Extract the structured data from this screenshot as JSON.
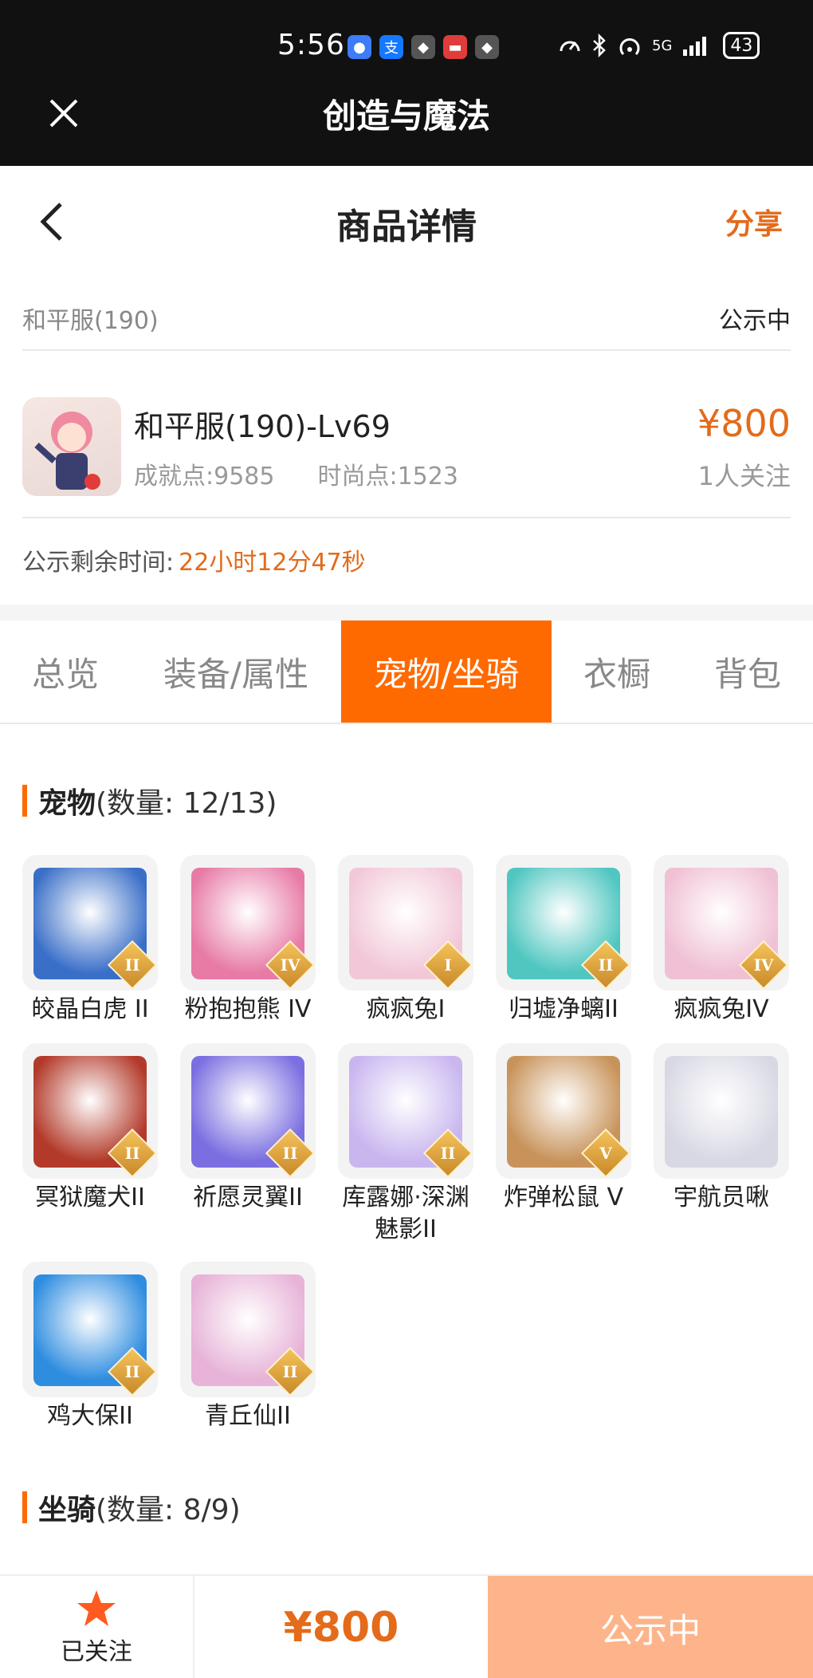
{
  "status_bar": {
    "time": "5:56",
    "signal": "5G",
    "battery": "43"
  },
  "app_bar": {
    "title": "创造与魔法"
  },
  "page": {
    "title": "商品详情",
    "share_label": "分享"
  },
  "listing": {
    "server": "和平服(190)",
    "status": "公示中",
    "character_name": "和平服(190)-Lv69",
    "achievement_points": "成就点:9585",
    "fashion_points": "时尚点:1523",
    "price": "¥800",
    "followers": "1人关注",
    "timer_label": "公示剩余时间:",
    "timer_value": "22小时12分47秒"
  },
  "tabs": [
    {
      "label": "总览"
    },
    {
      "label": "装备/属性"
    },
    {
      "label": "宠物/坐骑"
    },
    {
      "label": "衣橱"
    },
    {
      "label": "背包"
    }
  ],
  "active_tab": 2,
  "pets_section": {
    "title": "宠物",
    "count": "(数量: 12/13)",
    "items": [
      {
        "name": "皎晶白虎 II",
        "tier": "II",
        "color": "#3a6fc8"
      },
      {
        "name": "粉抱抱熊 IV",
        "tier": "IV",
        "color": "#e77ba6"
      },
      {
        "name": "疯疯兔I",
        "tier": "I",
        "color": "#f2c8d8"
      },
      {
        "name": "归墟净螭II",
        "tier": "II",
        "color": "#4fc6c0"
      },
      {
        "name": "疯疯兔IV",
        "tier": "IV",
        "color": "#f0c0d4"
      },
      {
        "name": "冥狱魔犬II",
        "tier": "II",
        "color": "#b33a2a"
      },
      {
        "name": "祈愿灵翼II",
        "tier": "II",
        "color": "#7a6ee0"
      },
      {
        "name": "库露娜·深渊魅影II",
        "tier": "II",
        "color": "#c9b6ef"
      },
      {
        "name": "炸弹松鼠 V",
        "tier": "V",
        "color": "#c8935a"
      },
      {
        "name": "宇航员啾",
        "tier": "",
        "color": "#d8d8e4"
      },
      {
        "name": "鸡大保II",
        "tier": "II",
        "color": "#2f8de0"
      },
      {
        "name": "青丘仙II",
        "tier": "II",
        "color": "#e7b3d8"
      }
    ]
  },
  "mounts_section": {
    "title": "坐骑",
    "count": "(数量: 8/9)"
  },
  "bottom_bar": {
    "follow_label": "已关注",
    "price": "¥800",
    "status_button": "公示中"
  },
  "colors": {
    "accent": "#ff6a00",
    "price": "#e36b1a",
    "status_button_bg": "#fdb48a"
  }
}
